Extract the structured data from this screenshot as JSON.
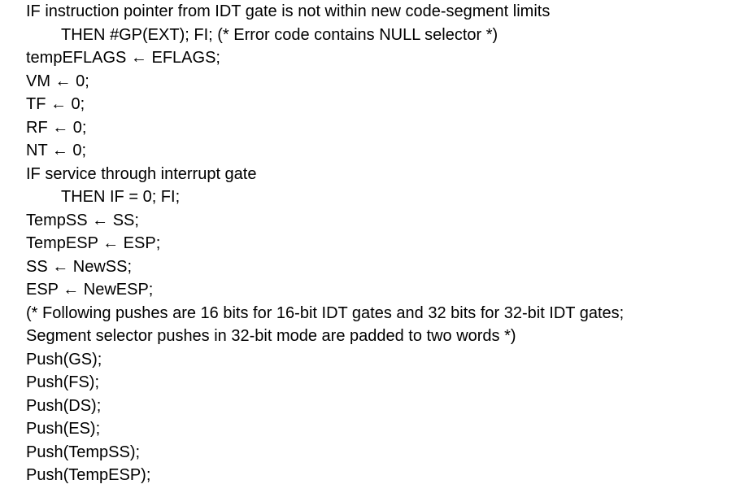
{
  "document": {
    "lines": [
      {
        "text": "IF instruction pointer from IDT gate is not within new code-segment limits",
        "indent": false
      },
      {
        "text": "THEN #GP(EXT); FI; (* Error code contains NULL selector *)",
        "indent": true
      },
      {
        "text": "tempEFLAGS ← EFLAGS;",
        "indent": false
      },
      {
        "text": "VM ← 0;",
        "indent": false
      },
      {
        "text": "TF ← 0;",
        "indent": false
      },
      {
        "text": "RF ← 0;",
        "indent": false
      },
      {
        "text": "NT ← 0;",
        "indent": false
      },
      {
        "text": "IF service through interrupt gate",
        "indent": false
      },
      {
        "text": "THEN IF = 0; FI;",
        "indent": true
      },
      {
        "text": "TempSS ← SS;",
        "indent": false
      },
      {
        "text": "TempESP ← ESP;",
        "indent": false
      },
      {
        "text": "SS ← NewSS;",
        "indent": false
      },
      {
        "text": "ESP ← NewESP;",
        "indent": false
      },
      {
        "text": "(* Following pushes are 16 bits for 16-bit IDT gates and 32 bits for 32-bit IDT gates;",
        "indent": false
      },
      {
        "text": "Segment selector pushes in 32-bit mode are padded to two words *)",
        "indent": false
      },
      {
        "text": "Push(GS);",
        "indent": false
      },
      {
        "text": "Push(FS);",
        "indent": false
      },
      {
        "text": "Push(DS);",
        "indent": false
      },
      {
        "text": "Push(ES);",
        "indent": false
      },
      {
        "text": "Push(TempSS);",
        "indent": false
      },
      {
        "text": "Push(TempESP);",
        "indent": false
      }
    ]
  }
}
